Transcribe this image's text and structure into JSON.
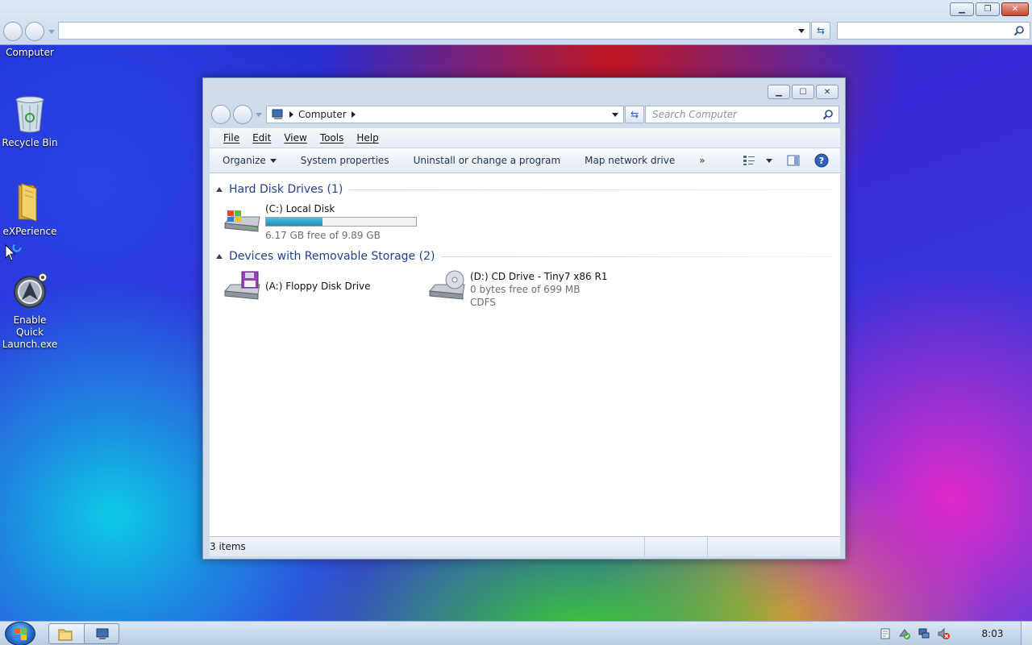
{
  "desktop": {
    "top_label": "Computer",
    "icons": [
      {
        "label": "Recycle Bin",
        "icon": "recycle-bin-icon"
      },
      {
        "label": "eXPerience",
        "icon": "folder-icon"
      },
      {
        "label": "Enable Quick Launch.exe",
        "icon": "app-icon"
      }
    ]
  },
  "explorer": {
    "breadcrumb": [
      "Computer"
    ],
    "search_placeholder": "Search Computer",
    "menu": [
      "File",
      "Edit",
      "View",
      "Tools",
      "Help"
    ],
    "commands": [
      "Organize",
      "System properties",
      "Uninstall or change a program",
      "Map network drive",
      "»"
    ],
    "groups": [
      {
        "title": "Hard Disk Drives (1)",
        "drives": [
          {
            "name": "(C:) Local Disk",
            "detail": "6.17 GB free of 9.89 GB",
            "used_fraction": 0.376
          }
        ]
      },
      {
        "title": "Devices with Removable Storage (2)",
        "drives": [
          {
            "name": "(A:) Floppy Disk Drive"
          },
          {
            "name": "(D:) CD Drive - Tiny7 x86 R1",
            "detail": "0 bytes free of 699 MB",
            "fs": "CDFS"
          }
        ]
      }
    ],
    "status": "3 items"
  },
  "taskbar": {
    "clock": "8:03"
  },
  "colors": {
    "link_blue": "#1f3f8f",
    "capacity_fill": "#26a0d0",
    "tray_error": "#d42a1a"
  }
}
